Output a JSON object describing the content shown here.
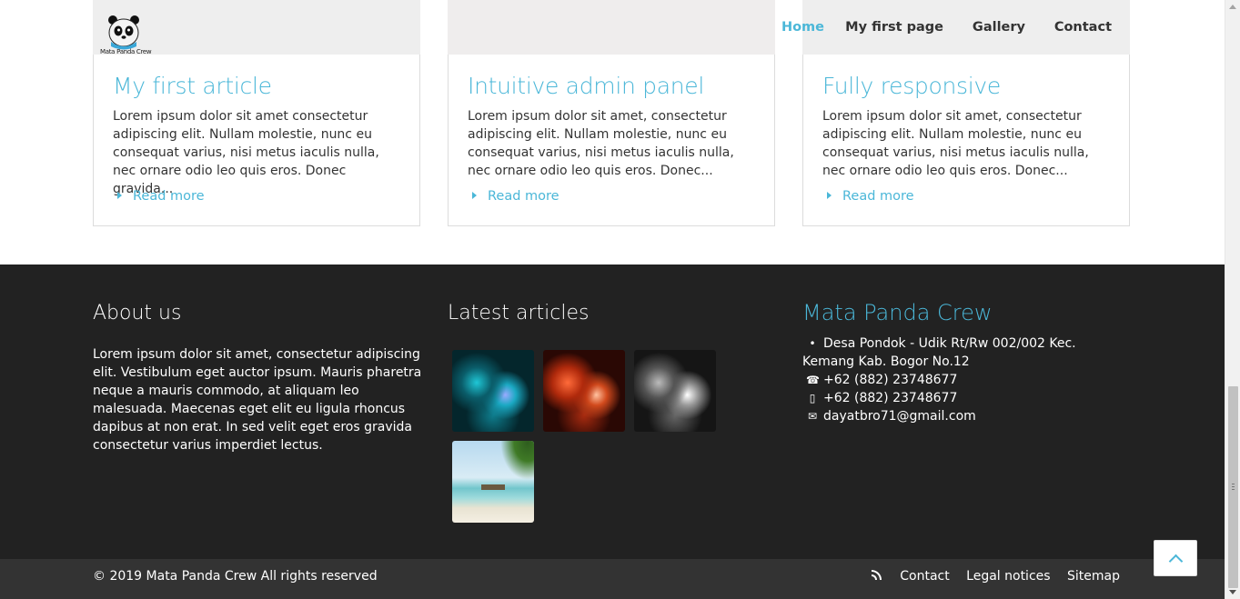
{
  "brand": {
    "logo_text": "Mata Panda Crew"
  },
  "nav": {
    "items": [
      {
        "label": "Home",
        "active": true
      },
      {
        "label": "My first page",
        "active": false
      },
      {
        "label": "Gallery",
        "active": false
      },
      {
        "label": "Contact",
        "active": false
      }
    ]
  },
  "articles": [
    {
      "title": "My first article",
      "text": "Lorem ipsum dolor sit amet consectetur adipiscing elit. Nullam molestie, nunc eu consequat varius, nisi metus iaculis nulla, nec ornare odio leo quis eros. Donec gravida...",
      "more": "Read more"
    },
    {
      "title": "Intuitive admin panel",
      "text": "Lorem ipsum dolor sit amet, consectetur adipiscing elit. Nullam molestie, nunc eu consequat varius, nisi metus iaculis nulla, nec ornare odio leo quis eros. Donec...",
      "more": "Read more"
    },
    {
      "title": "Fully responsive",
      "text": "Lorem ipsum dolor sit amet, consectetur adipiscing elit. Nullam molestie, nunc eu consequat varius, nisi metus iaculis nulla, nec ornare odio leo quis eros. Donec...",
      "more": "Read more"
    }
  ],
  "footer": {
    "about": {
      "heading": "About us",
      "text": "Lorem ipsum dolor sit amet, consectetur adipiscing elit. Vestibulum eget auctor ipsum. Mauris pharetra neque a mauris commodo, at aliquam leo malesuada. Maecenas eget elit eu ligula rhoncus dapibus at non erat. In sed velit eget eros gravida consectetur varius imperdiet lectus."
    },
    "latest": {
      "heading": "Latest articles"
    },
    "contact": {
      "heading": "Mata Panda Crew",
      "address": "Desa Pondok - Udik Rt/Rw 002/002 Kec. Kemang Kab. Bogor No.12",
      "phone": "+62 (882) 23748677",
      "mobile": "+62 (882) 23748677",
      "email": "dayatbro71@gmail.com"
    }
  },
  "bottombar": {
    "copyright": "© 2019 Mata Panda Crew All rights reserved",
    "links": {
      "contact": "Contact",
      "legal": "Legal notices",
      "sitemap": "Sitemap"
    }
  },
  "colors": {
    "accent": "#4bb7d8",
    "footer_bg": "#222222",
    "bottombar_bg": "#333333"
  }
}
